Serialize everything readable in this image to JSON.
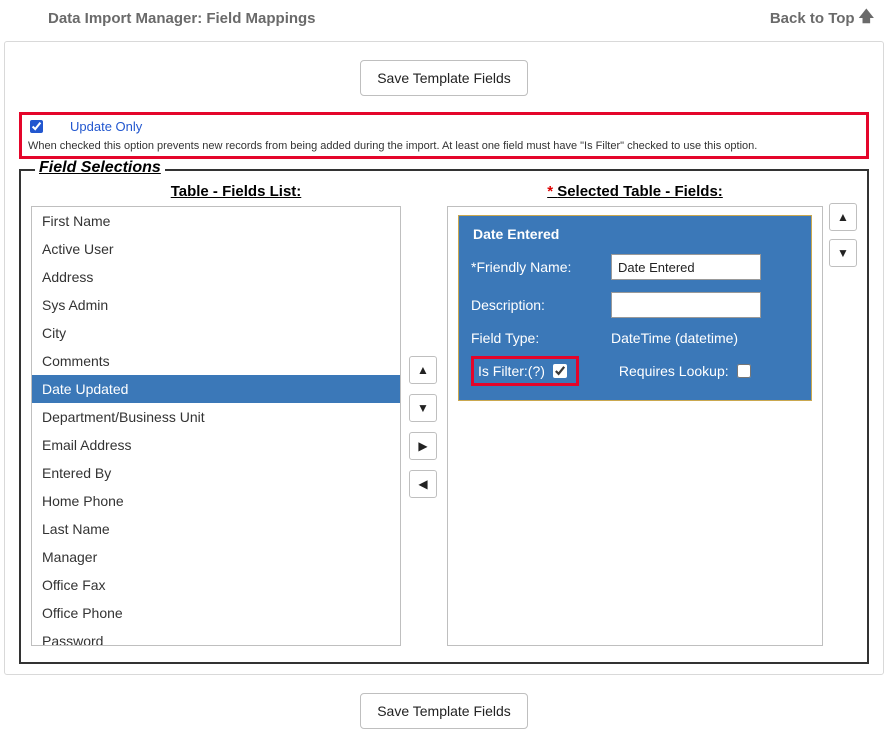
{
  "header": {
    "title": "Data Import Manager: Field Mappings",
    "back_to_top": "Back to Top"
  },
  "buttons": {
    "save_template_top": "Save Template Fields",
    "save_template_bottom": "Save Template Fields"
  },
  "update_only": {
    "label": "Update Only",
    "checked": true,
    "description": "When checked this option prevents new records from being added during the import. At least one field must have \"Is Filter\" checked to use this option."
  },
  "fieldset": {
    "legend": "Field Selections",
    "left_head": "Table - Fields List:",
    "right_head": "Selected Table - Fields:"
  },
  "fields_list": {
    "items": [
      "First Name",
      "Active User",
      "Address",
      "Sys Admin",
      "City",
      "Comments",
      "Date Updated",
      "Department/Business Unit",
      "Email Address",
      "Entered By",
      "Home Phone",
      "Last Name",
      "Manager",
      "Office Fax",
      "Office Phone",
      "Password"
    ],
    "selected_index": 6
  },
  "move_buttons": {
    "up_all": "▲",
    "down_all": "▼",
    "right": "▶",
    "left": "◀"
  },
  "reorder_buttons": {
    "up": "▲",
    "down": "▼"
  },
  "selected_field": {
    "legend": "Date Entered",
    "friendly_name_label": "*Friendly Name:",
    "friendly_name_value": "Date Entered",
    "description_label": "Description:",
    "description_value": "",
    "field_type_label": "Field Type:",
    "field_type_value": "DateTime (datetime)",
    "is_filter_label": "Is Filter:(?)",
    "is_filter_checked": true,
    "requires_lookup_label": "Requires Lookup:",
    "requires_lookup_checked": false
  }
}
